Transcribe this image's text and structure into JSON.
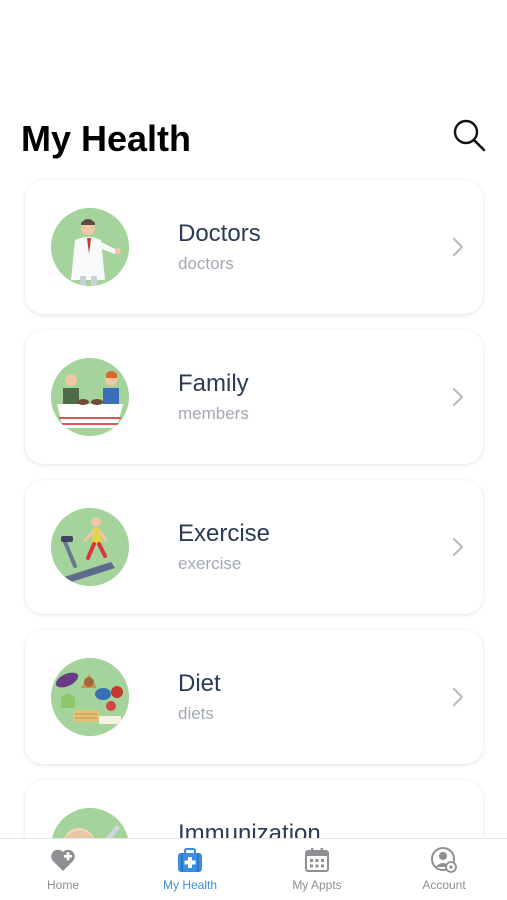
{
  "header": {
    "title": "My Health",
    "search_icon": "search-icon"
  },
  "categories": [
    {
      "title": "Doctors",
      "subtitle": "doctors",
      "icon": "doctor-illustration"
    },
    {
      "title": "Family",
      "subtitle": "members",
      "icon": "family-illustration"
    },
    {
      "title": "Exercise",
      "subtitle": "exercise",
      "icon": "treadmill-illustration"
    },
    {
      "title": "Diet",
      "subtitle": "diets",
      "icon": "food-illustration"
    },
    {
      "title": "Immunization",
      "subtitle": "",
      "icon": "baby-vaccine-illustration"
    }
  ],
  "tabbar": {
    "active_color": "#3b8de0",
    "inactive_color": "#8e8e93",
    "items": [
      {
        "label": "Home",
        "icon": "heart-plus-icon"
      },
      {
        "label": "My Health",
        "icon": "medical-kit-icon"
      },
      {
        "label": "My Appts",
        "icon": "calendar-icon"
      },
      {
        "label": "Account",
        "icon": "account-settings-icon"
      }
    ]
  }
}
